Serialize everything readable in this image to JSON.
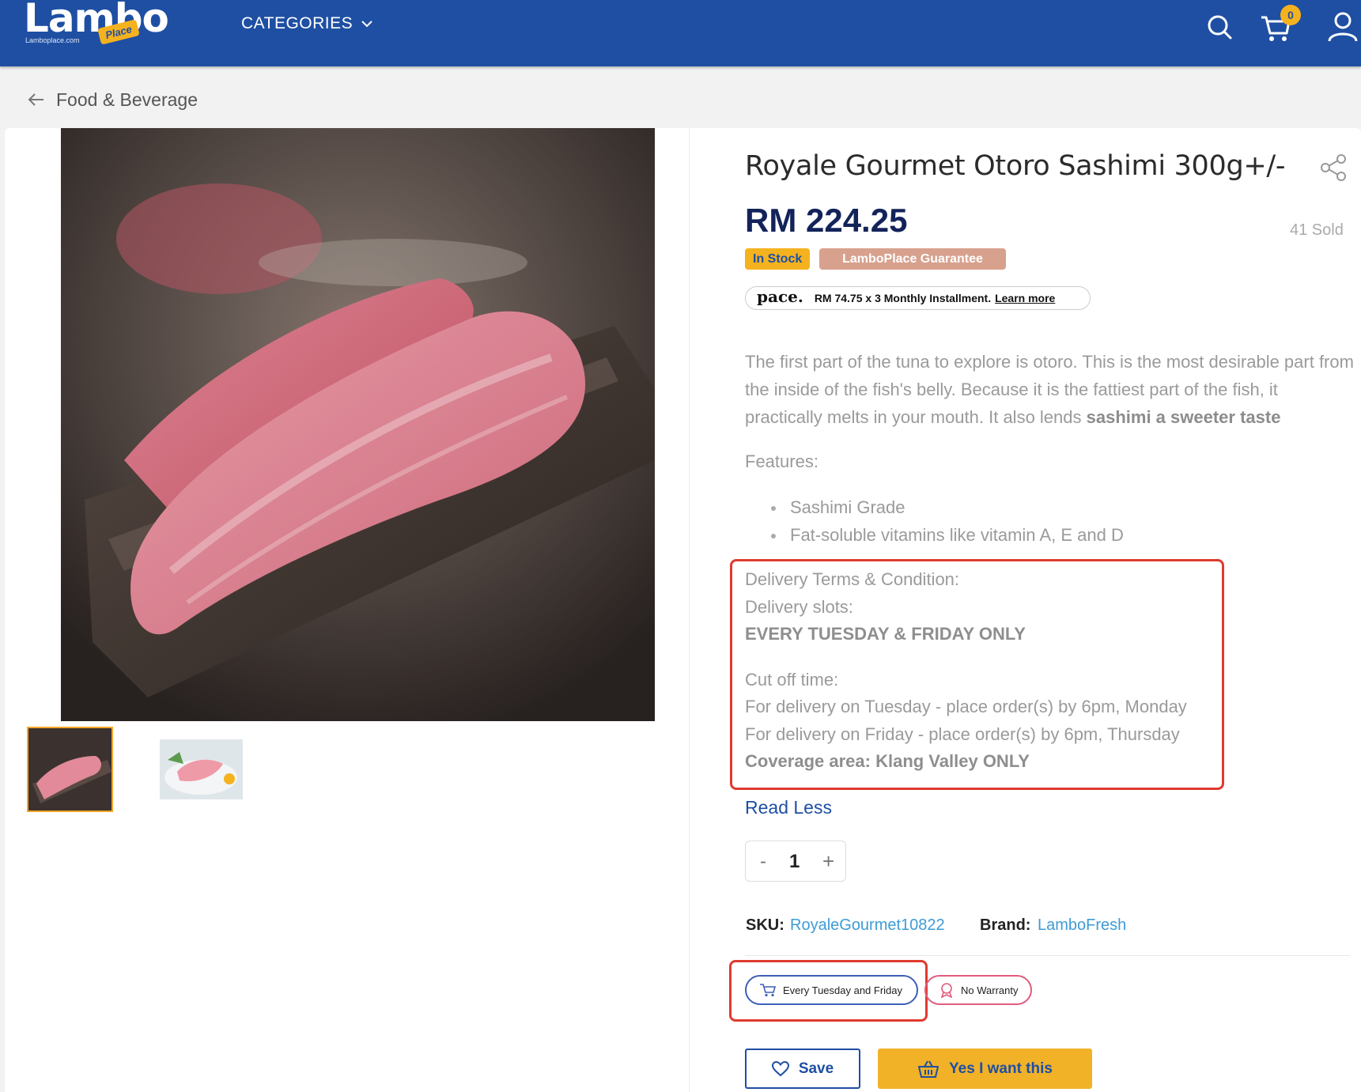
{
  "header": {
    "logo_word": "Lambo",
    "logo_sub": "Lamboplace.com",
    "logo_tag": "Place",
    "categories_label": "CATEGORIES",
    "cart_count": "0",
    "colors": {
      "bar": "#1e4fa3",
      "accent": "#f5b21f"
    },
    "icons": [
      "search-icon",
      "cart-icon",
      "user-icon",
      "chevron-down-icon"
    ]
  },
  "breadcrumb": {
    "label": "Food & Beverage",
    "icon": "arrow-left-icon"
  },
  "gallery": {
    "thumbnails": 2,
    "active_index": 0
  },
  "product": {
    "title": "Royale Gourmet Otoro Sashimi 300g+/-",
    "price": "RM 224.25",
    "sold": "41 Sold",
    "badges": {
      "stock": "In Stock",
      "guarantee": "LamboPlace Guarantee"
    },
    "pace": {
      "logo": "pace.",
      "text": "RM 74.75 x 3 Monthly Installment.",
      "link": "Learn more"
    },
    "description": {
      "part1": "The first part of the tuna to explore is otoro. This is the most desirable part from the inside of the fish's belly. Because it is the fattiest part of the fish, it practically melts in your mouth. It also lends ",
      "bold": "sashimi a sweeter taste"
    },
    "features_heading": "Features:",
    "features": [
      "Sashimi Grade",
      "Fat-soluble vitamins like vitamin A, E and D"
    ],
    "delivery": {
      "heading": "Delivery Terms & Condition:",
      "slots_label": "Delivery slots:",
      "slots_value": "EVERY TUESDAY & FRIDAY ONLY",
      "cutoff_label": "Cut off time:",
      "cutoff_tue": "For delivery on Tuesday - place order(s) by 6pm, Monday",
      "cutoff_fri": "For delivery on Friday - place order(s) by 6pm, Thursday",
      "coverage": "Coverage area: Klang Valley ONLY"
    },
    "read_less": "Read Less",
    "quantity": {
      "minus": "-",
      "value": "1",
      "plus": "+"
    },
    "sku_label": "SKU:",
    "sku_value": "RoyaleGourmet10822",
    "brand_label": "Brand:",
    "brand_value": "LamboFresh",
    "pills": {
      "delivery": "Every Tuesday and Friday",
      "warranty": "No Warranty"
    },
    "buttons": {
      "save": "Save",
      "buy": "Yes I want this"
    }
  }
}
